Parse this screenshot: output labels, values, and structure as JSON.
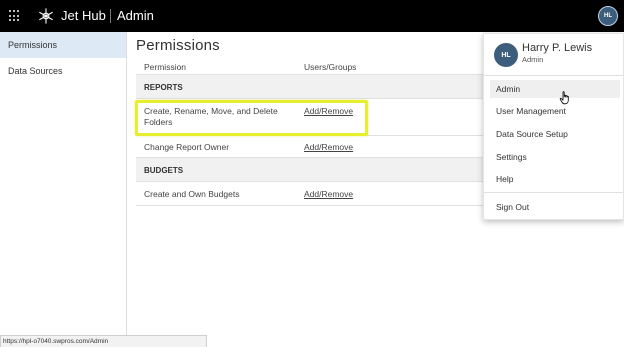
{
  "header": {
    "app_title": "Jet Hub",
    "section": "Admin",
    "avatar_initials": "HL"
  },
  "sidebar": {
    "items": [
      {
        "label": "Permissions",
        "active": true
      },
      {
        "label": "Data Sources",
        "active": false
      }
    ]
  },
  "main": {
    "title": "Permissions",
    "columns": [
      "Permission",
      "Users/Groups"
    ],
    "groups": [
      {
        "name": "REPORTS",
        "rows": [
          {
            "permission": "Create, Rename, Move, and Delete Folders",
            "link": "Add/Remove"
          },
          {
            "permission": "Change Report Owner",
            "link": "Add/Remove"
          }
        ]
      },
      {
        "name": "BUDGETS",
        "rows": [
          {
            "permission": "Create and Own Budgets",
            "link": "Add/Remove"
          }
        ]
      }
    ]
  },
  "user_menu": {
    "initials": "HL",
    "name": "Harry P. Lewis",
    "role": "Admin",
    "items": [
      "Admin",
      "User Management",
      "Data Source Setup",
      "Settings",
      "Help"
    ],
    "sign_out": "Sign Out"
  },
  "status_bar": {
    "url": "https://hpl-o7040.swpros.com/Admin"
  },
  "colors": {
    "topbar": "#000000",
    "highlight": "#e6ee2e",
    "sidebar_active": "#dde9f5",
    "avatar": "#3c5d7c"
  }
}
